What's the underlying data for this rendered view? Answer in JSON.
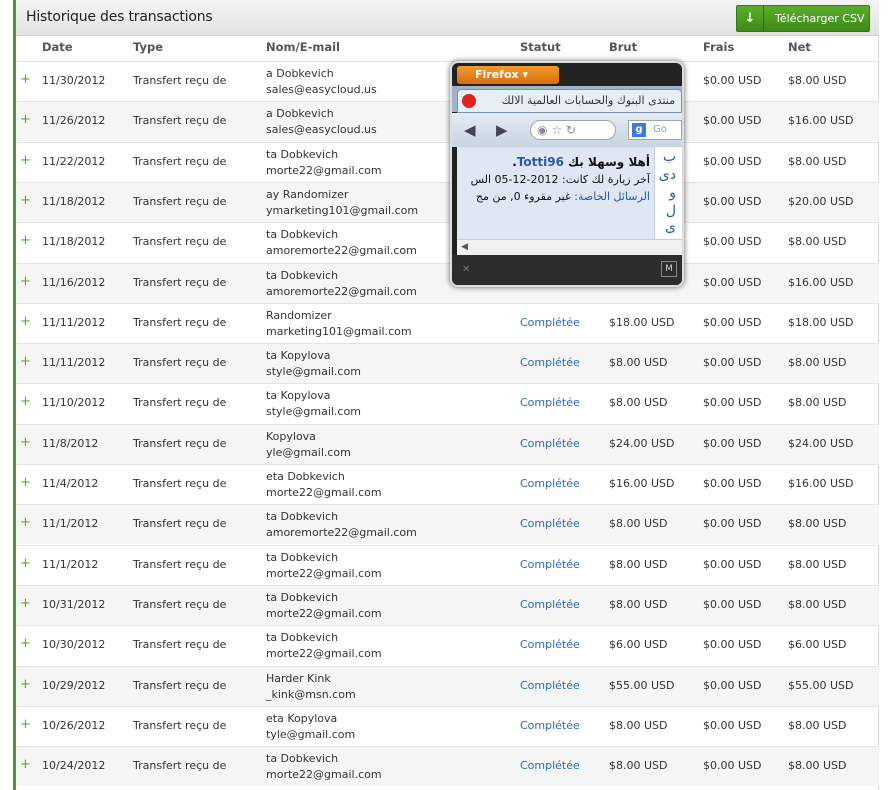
{
  "header": {
    "title": "Historique des transactions",
    "csv_button_label": "Télécharger CSV",
    "csv_button_icon": "download-arrow-icon"
  },
  "columns": {
    "date": "Date",
    "type": "Type",
    "name": "Nom/E-mail",
    "status": "Statut",
    "brut": "Brut",
    "frais": "Frais",
    "net": "Net"
  },
  "rows": [
    {
      "date": "11/30/2012",
      "type": "Transfert reçu de",
      "name": "a Dobkevich",
      "email": "sales@easycloud.us",
      "status": "",
      "brut": "",
      "frais": "$0.00 USD",
      "net": "$8.00 USD"
    },
    {
      "date": "11/26/2012",
      "type": "Transfert reçu de",
      "name": "a Dobkevich",
      "email": "sales@easycloud.us",
      "status": "",
      "brut": "",
      "frais": "$0.00 USD",
      "net": "$16.00 USD"
    },
    {
      "date": "11/22/2012",
      "type": "Transfert reçu de",
      "name": "ta Dobkevich",
      "email": "morte22@gmail.com",
      "status": "",
      "brut": "",
      "frais": "$0.00 USD",
      "net": "$8.00 USD"
    },
    {
      "date": "11/18/2012",
      "type": "Transfert reçu de",
      "name": "ay Randomizer",
      "email": "ymarketing101@gmail.com",
      "status": "",
      "brut": "",
      "frais": "$0.00 USD",
      "net": "$20.00 USD"
    },
    {
      "date": "11/18/2012",
      "type": "Transfert reçu de",
      "name": "ta Dobkevich",
      "email": "amoremorte22@gmail.com",
      "status": "",
      "brut": "",
      "frais": "$0.00 USD",
      "net": "$8.00 USD"
    },
    {
      "date": "11/16/2012",
      "type": "Transfert reçu de",
      "name": "ta Dobkevich",
      "email": "amoremorte22@gmail.com",
      "status": "",
      "brut": "",
      "frais": "$0.00 USD",
      "net": "$16.00 USD"
    },
    {
      "date": "11/11/2012",
      "type": "Transfert reçu de",
      "name": "Randomizer",
      "email": "marketing101@gmail.com",
      "status": "Complétée",
      "brut": "$18.00 USD",
      "frais": "$0.00 USD",
      "net": "$18.00 USD"
    },
    {
      "date": "11/11/2012",
      "type": "Transfert reçu de",
      "name": "ta Kopylova",
      "email": "style@gmail.com",
      "status": "Complétée",
      "brut": "$8.00 USD",
      "frais": "$0.00 USD",
      "net": "$8.00 USD"
    },
    {
      "date": "11/10/2012",
      "type": "Transfert reçu de",
      "name": "ta Kopylova",
      "email": "style@gmail.com",
      "status": "Complétée",
      "brut": "$8.00 USD",
      "frais": "$0.00 USD",
      "net": "$8.00 USD"
    },
    {
      "date": "11/8/2012",
      "type": "Transfert reçu de",
      "name": "Kopylova",
      "email": "yle@gmail.com",
      "status": "Complétée",
      "brut": "$24.00 USD",
      "frais": "$0.00 USD",
      "net": "$24.00 USD"
    },
    {
      "date": "11/4/2012",
      "type": "Transfert reçu de",
      "name": "eta Dobkevich",
      "email": "morte22@gmail.com",
      "status": "Complétée",
      "brut": "$16.00 USD",
      "frais": "$0.00 USD",
      "net": "$16.00 USD"
    },
    {
      "date": "11/1/2012",
      "type": "Transfert reçu de",
      "name": "ta Dobkevich",
      "email": "amoremorte22@gmail.com",
      "status": "Complétée",
      "brut": "$8.00 USD",
      "frais": "$0.00 USD",
      "net": "$8.00 USD"
    },
    {
      "date": "11/1/2012",
      "type": "Transfert reçu de",
      "name": "ta Dobkevich",
      "email": "morte22@gmail.com",
      "status": "Complétée",
      "brut": "$8.00 USD",
      "frais": "$0.00 USD",
      "net": "$8.00 USD"
    },
    {
      "date": "10/31/2012",
      "type": "Transfert reçu de",
      "name": "ta Dobkevich",
      "email": "morte22@gmail.com",
      "status": "Complétée",
      "brut": "$8.00 USD",
      "frais": "$0.00 USD",
      "net": "$8.00 USD"
    },
    {
      "date": "10/30/2012",
      "type": "Transfert reçu de",
      "name": "ta Dobkevich",
      "email": "morte22@gmail.com",
      "status": "Complétée",
      "brut": "$6.00 USD",
      "frais": "$0.00 USD",
      "net": "$6.00 USD"
    },
    {
      "date": "10/29/2012",
      "type": "Transfert reçu de",
      "name": "Harder Kink",
      "email": "_kink@msn.com",
      "status": "Complétée",
      "brut": "$55.00 USD",
      "frais": "$0.00 USD",
      "net": "$55.00 USD"
    },
    {
      "date": "10/26/2012",
      "type": "Transfert reçu de",
      "name": "eta Kopylova",
      "email": "tyle@gmail.com",
      "status": "Complétée",
      "brut": "$8.00 USD",
      "frais": "$0.00 USD",
      "net": "$8.00 USD"
    },
    {
      "date": "10/24/2012",
      "type": "Transfert reçu de",
      "name": "ta Dobkevich",
      "email": "morte22@gmail.com",
      "status": "Complétée",
      "brut": "$8.00 USD",
      "frais": "$0.00 USD",
      "net": "$8.00 USD"
    }
  ],
  "popup": {
    "firefox_label": "Firefox",
    "tab_title": "منتدى البنوك والحسابات العالمية الالك",
    "url_icon": "globe-icon",
    "search_placeholder": "Go",
    "welcome_text": "أهلا وسهلا بك ",
    "username": "Totti96",
    "last_visit": "آخر زيارة لك كانت: 2012-12-05 الس",
    "messages_label": "الرسائل الخاصة:",
    "messages_value": " غير مقروء 0, من مج",
    "side_chars": [
      "ب",
      "دى",
      "و",
      "ل",
      "ى"
    ]
  }
}
